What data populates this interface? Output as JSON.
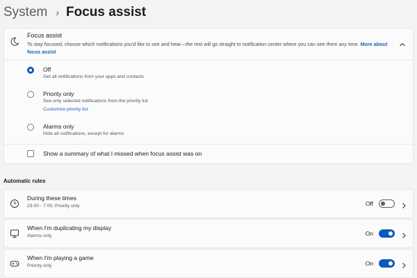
{
  "breadcrumb": {
    "parent": "System",
    "separator": "›",
    "current": "Focus assist"
  },
  "focus_assist": {
    "title": "Focus assist",
    "description": "To stay focused, choose which notifications you'd like to see and hear—the rest will go straight to notification center where you can see them any time.",
    "more_link": "More about focus assist",
    "options": [
      {
        "label": "Off",
        "desc": "Get all notifications from your apps and contacts",
        "selected": true
      },
      {
        "label": "Priority only",
        "desc": "See only selected notifications from the priority list",
        "link": "Customize priority list",
        "selected": false
      },
      {
        "label": "Alarms only",
        "desc": "Hide all notifications, except for alarms",
        "selected": false
      }
    ],
    "summary_checkbox": {
      "label": "Show a summary of what I missed when focus assist was on",
      "checked": false
    }
  },
  "automatic_rules": {
    "title": "Automatic rules",
    "rules": [
      {
        "title": "During these times",
        "subtitle": "23:00 - 7:00; Priority only",
        "state": "Off",
        "icon": "clock-icon"
      },
      {
        "title": "When I'm duplicating my display",
        "subtitle": "Alarms only",
        "state": "On",
        "icon": "monitor-icon"
      },
      {
        "title": "When I'm playing a game",
        "subtitle": "Priority only",
        "state": "On",
        "icon": "gamepad-icon"
      }
    ]
  },
  "colors": {
    "accent": "#0a5bbd",
    "link": "#1a5fb4",
    "background": "#f3f3f3",
    "card": "#fbfbfb"
  }
}
